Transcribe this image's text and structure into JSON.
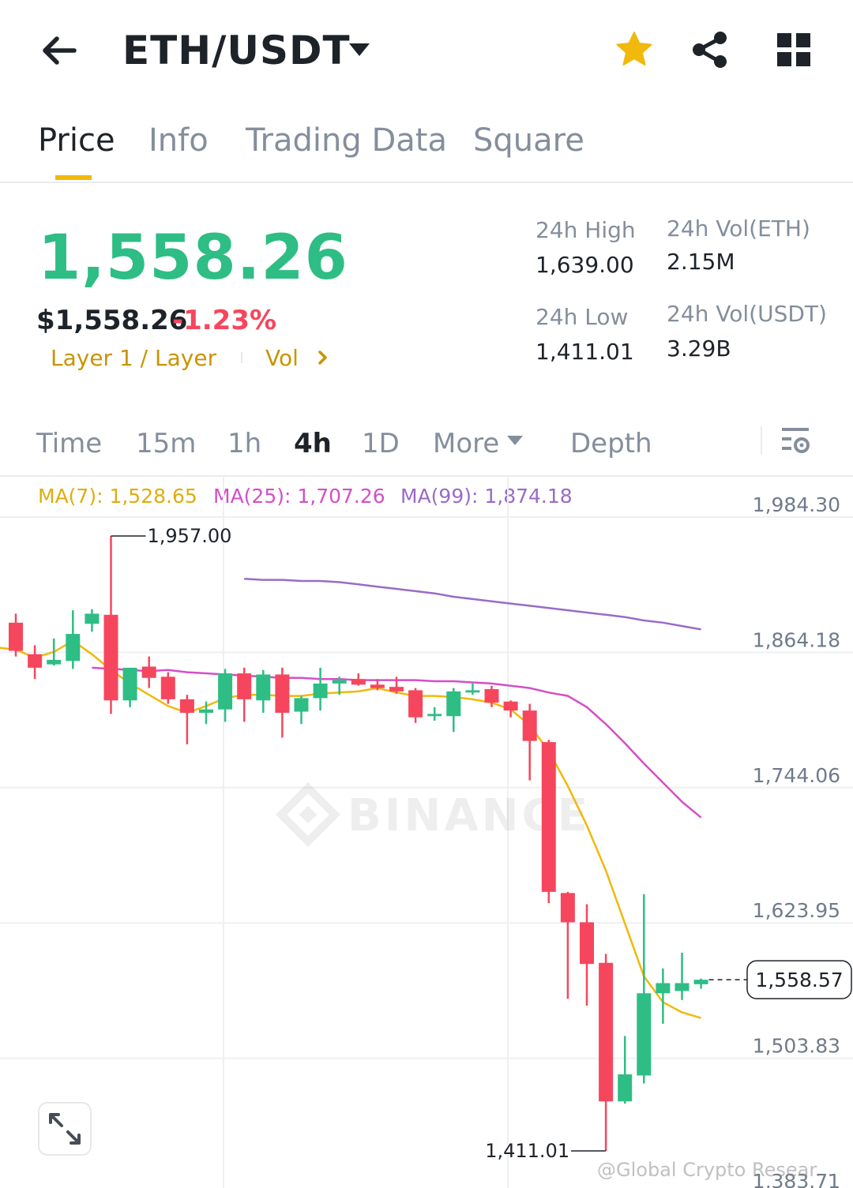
{
  "header": {
    "pair": "ETH/USDT"
  },
  "tabs": [
    {
      "label": "Price"
    },
    {
      "label": "Info"
    },
    {
      "label": "Trading Data"
    },
    {
      "label": "Square"
    }
  ],
  "price": {
    "last": "1,558.26",
    "usd": "$1,558.26",
    "change": "-1.23%",
    "tag_sector": "Layer 1 / Layer",
    "tag_vol": "Vol"
  },
  "stats": {
    "high_label": "24h High",
    "high_value": "1,639.00",
    "low_label": "24h Low",
    "low_value": "1,411.01",
    "vol_eth_label": "24h Vol(ETH)",
    "vol_eth_value": "2.15M",
    "vol_usdt_label": "24h Vol(USDT)",
    "vol_usdt_value": "3.29B"
  },
  "intervals": [
    {
      "label": "Time"
    },
    {
      "label": "15m"
    },
    {
      "label": "1h"
    },
    {
      "label": "4h"
    },
    {
      "label": "1D"
    },
    {
      "label": "More"
    },
    {
      "label": "Depth"
    }
  ],
  "ma_legend": {
    "ma7": "MA(7): 1,528.65",
    "ma25": "MA(25): 1,707.26",
    "ma99": "MA(99): 1,874.18"
  },
  "colors": {
    "up": "#2ebd85",
    "down": "#f6465d",
    "accent": "#f0b90b",
    "ma7": "#f0b90b",
    "ma25": "#d44fc6",
    "ma99": "#9a6bc6"
  },
  "watermark": "@Global Crypto Resear...",
  "chart_data": {
    "type": "candlestick",
    "interval": "4h",
    "y_axis_ticks": [
      "1,984.30",
      "1,864.18",
      "1,744.06",
      "1,623.95",
      "1,503.83",
      "1,383.71"
    ],
    "ylim": [
      1383.71,
      1984.3
    ],
    "current_price_label": "1,558.57",
    "high_marker": {
      "label": "1,957.00",
      "value": 1957.0
    },
    "low_marker": {
      "label": "1,411.01",
      "value": 1411.01
    },
    "candles": [
      {
        "o": 1880,
        "h": 1888,
        "c": 1855,
        "l": 1850
      },
      {
        "o": 1852,
        "h": 1860,
        "c": 1840,
        "l": 1830
      },
      {
        "o": 1843,
        "h": 1866,
        "c": 1847,
        "l": 1842
      },
      {
        "o": 1846,
        "h": 1891,
        "c": 1870,
        "l": 1839
      },
      {
        "o": 1879,
        "h": 1892,
        "c": 1888,
        "l": 1872
      },
      {
        "o": 1887,
        "h": 1957,
        "c": 1811,
        "l": 1799
      },
      {
        "o": 1811,
        "h": 1826,
        "c": 1840,
        "l": 1805
      },
      {
        "o": 1841,
        "h": 1850,
        "c": 1831,
        "l": 1822
      },
      {
        "o": 1832,
        "h": 1836,
        "c": 1812,
        "l": 1808
      },
      {
        "o": 1812,
        "h": 1816,
        "c": 1800,
        "l": 1772
      },
      {
        "o": 1800,
        "h": 1810,
        "c": 1803,
        "l": 1790
      },
      {
        "o": 1803,
        "h": 1839,
        "c": 1835,
        "l": 1792
      },
      {
        "o": 1835,
        "h": 1840,
        "c": 1812,
        "l": 1792
      },
      {
        "o": 1811,
        "h": 1838,
        "c": 1834,
        "l": 1800
      },
      {
        "o": 1834,
        "h": 1840,
        "c": 1800,
        "l": 1778
      },
      {
        "o": 1801,
        "h": 1815,
        "c": 1813,
        "l": 1790
      },
      {
        "o": 1813,
        "h": 1840,
        "c": 1826,
        "l": 1802
      },
      {
        "o": 1826,
        "h": 1832,
        "c": 1829,
        "l": 1816
      },
      {
        "o": 1830,
        "h": 1835,
        "c": 1825,
        "l": 1824
      },
      {
        "o": 1825,
        "h": 1830,
        "c": 1822,
        "l": 1820
      },
      {
        "o": 1823,
        "h": 1832,
        "c": 1819,
        "l": 1817
      },
      {
        "o": 1820,
        "h": 1822,
        "c": 1796,
        "l": 1791
      },
      {
        "o": 1797,
        "h": 1805,
        "c": 1799,
        "l": 1793
      },
      {
        "o": 1797,
        "h": 1822,
        "c": 1819,
        "l": 1783
      },
      {
        "o": 1818,
        "h": 1826,
        "c": 1820,
        "l": 1816
      },
      {
        "o": 1821,
        "h": 1824,
        "c": 1809,
        "l": 1805
      },
      {
        "o": 1810,
        "h": 1811,
        "c": 1802,
        "l": 1796
      },
      {
        "o": 1802,
        "h": 1808,
        "c": 1775,
        "l": 1740
      },
      {
        "o": 1774,
        "h": 1776,
        "c": 1641,
        "l": 1631
      },
      {
        "o": 1640,
        "h": 1641,
        "c": 1614,
        "l": 1546
      },
      {
        "o": 1614,
        "h": 1630,
        "c": 1577,
        "l": 1540
      },
      {
        "o": 1578,
        "h": 1586,
        "c": 1455,
        "l": 1411.01
      },
      {
        "o": 1455,
        "h": 1513,
        "c": 1479,
        "l": 1453
      },
      {
        "o": 1478,
        "h": 1639,
        "c": 1551,
        "l": 1471
      },
      {
        "o": 1551,
        "h": 1573,
        "c": 1560,
        "l": 1524
      },
      {
        "o": 1553,
        "h": 1587,
        "c": 1560,
        "l": 1545
      },
      {
        "o": 1559,
        "h": 1564,
        "c": 1563,
        "l": 1555
      }
    ],
    "ma7": [
      1858,
      1856,
      1849,
      1854,
      1864,
      1852,
      1838,
      1826,
      1816,
      1806,
      1800,
      1806,
      1813,
      1816,
      1816,
      1815,
      1815,
      1817,
      1818,
      1819,
      1822,
      1818,
      1815,
      1815,
      1814,
      1812,
      1809,
      1803,
      1789,
      1766,
      1735,
      1700,
      1660,
      1613,
      1566,
      1543,
      1534,
      1529
    ],
    "ma25": [
      1840,
      1839,
      1838,
      1837,
      1838,
      1836,
      1835,
      1834,
      1833,
      1832,
      1831,
      1831,
      1830,
      1830,
      1829,
      1829,
      1829,
      1829,
      1828,
      1828,
      1827,
      1826,
      1824,
      1822,
      1818,
      1815,
      1805,
      1790,
      1773,
      1755,
      1738,
      1721,
      1707
    ],
    "ma99": [
      1919,
      1918,
      1918,
      1917,
      1917,
      1916,
      1914,
      1912,
      1910,
      1908,
      1906,
      1903,
      1901,
      1899,
      1897,
      1895,
      1893,
      1891,
      1889,
      1887,
      1885,
      1882,
      1880,
      1877,
      1874
    ]
  }
}
